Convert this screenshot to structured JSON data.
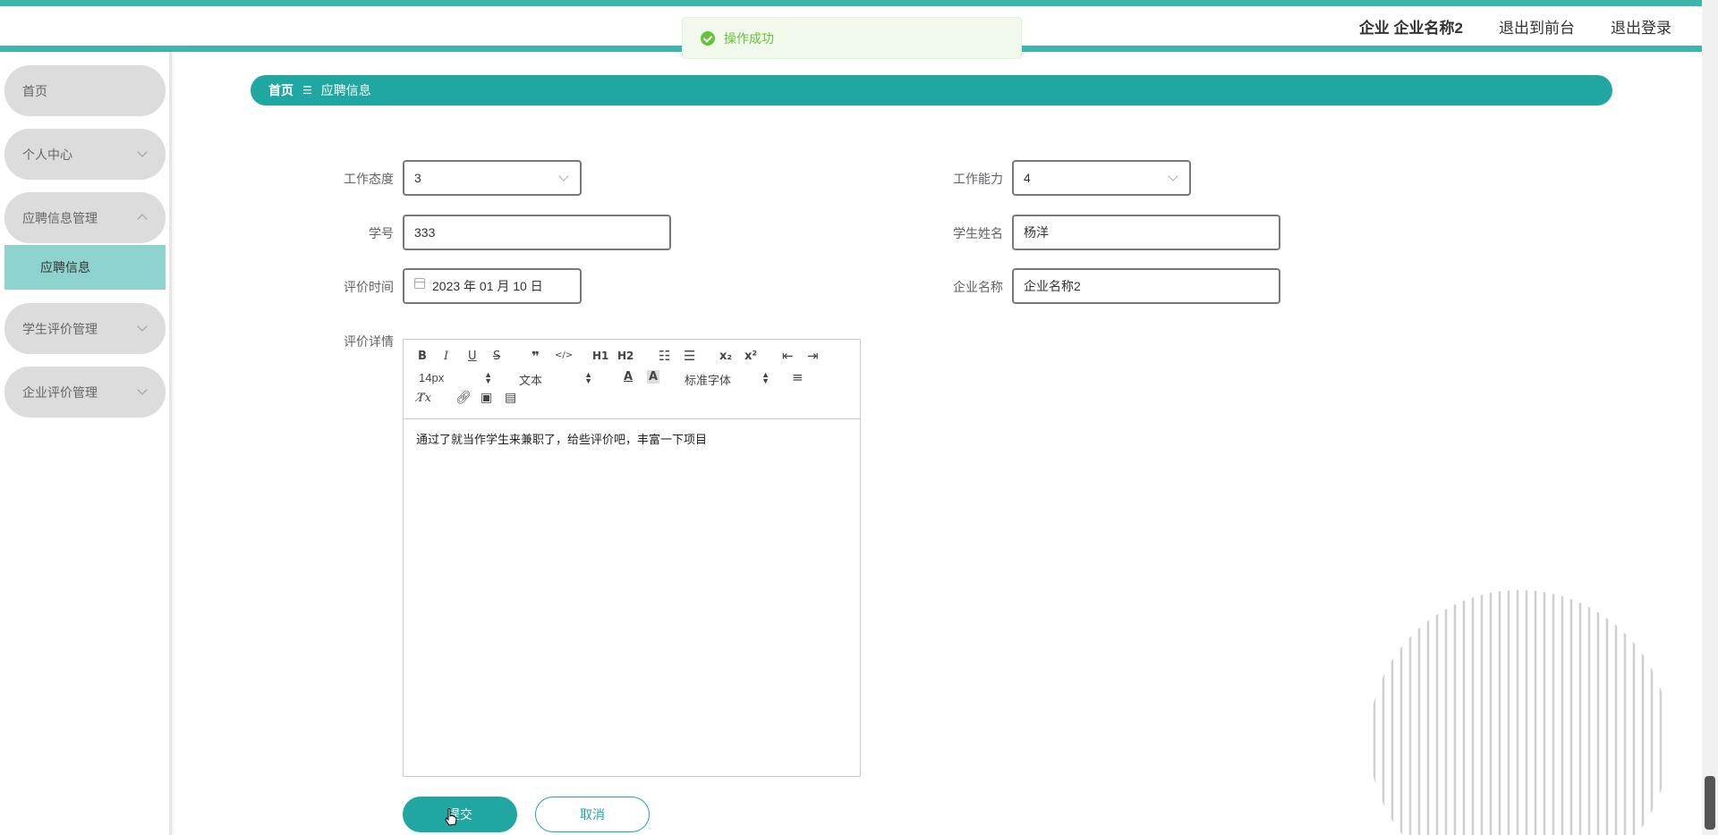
{
  "header": {
    "user_label": "企业 企业名称2",
    "to_front_label": "退出到前台",
    "logout_label": "退出登录"
  },
  "toast": {
    "message": "操作成功",
    "color": "#67c23a"
  },
  "theme": {
    "accent": "#20a7a1",
    "menu_bg": "#dcdcdc",
    "submenu_bg": "#8fd3cf"
  },
  "sidebar": {
    "items": [
      {
        "label": "首页"
      },
      {
        "label": "个人中心"
      },
      {
        "label": "应聘信息管理"
      },
      {
        "label": "学生评价管理"
      },
      {
        "label": "企业评价管理"
      }
    ],
    "active_sub": "应聘信息"
  },
  "breadcrumb": {
    "home": "首页",
    "separator": "☰",
    "current": "应聘信息"
  },
  "form": {
    "attitude": {
      "label": "工作态度",
      "value": "3"
    },
    "ability": {
      "label": "工作能力",
      "value": "4"
    },
    "student_id": {
      "label": "学号",
      "value": "333"
    },
    "student_name": {
      "label": "学生姓名",
      "value": "杨洋"
    },
    "eval_time": {
      "label": "评价时间",
      "value": "2023 年 01 月 10 日"
    },
    "company_name": {
      "label": "企业名称",
      "value": "企业名称2"
    },
    "detail": {
      "label": "评价详情",
      "content": "通过了就当作学生来兼职了，给些评价吧，丰富一下项目",
      "toolbar": {
        "quote": "❞",
        "code": "</>",
        "h1": "H1",
        "h2": "H2",
        "sub": "x₂",
        "sup": "x²",
        "size": "14px",
        "header": "文本",
        "font": "标准字体",
        "clean": "T̸x"
      }
    }
  },
  "actions": {
    "submit": "提交",
    "cancel": "取消"
  }
}
